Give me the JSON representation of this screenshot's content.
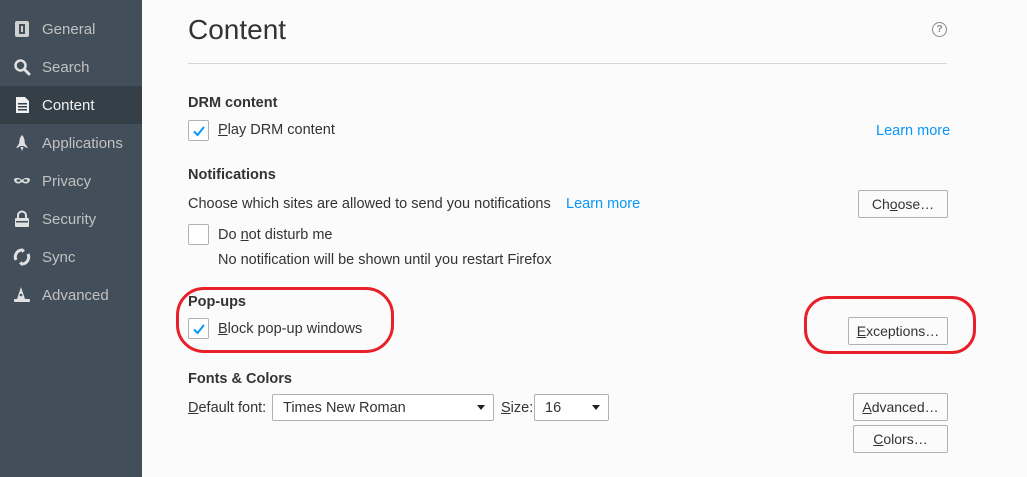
{
  "sidebar": {
    "items": [
      {
        "label": "General",
        "icon": "general-icon",
        "selected": false
      },
      {
        "label": "Search",
        "icon": "search-icon",
        "selected": false
      },
      {
        "label": "Content",
        "icon": "content-icon",
        "selected": true
      },
      {
        "label": "Applications",
        "icon": "rocket-icon",
        "selected": false
      },
      {
        "label": "Privacy",
        "icon": "mask-icon",
        "selected": false
      },
      {
        "label": "Security",
        "icon": "lock-icon",
        "selected": false
      },
      {
        "label": "Sync",
        "icon": "sync-icon",
        "selected": false
      },
      {
        "label": "Advanced",
        "icon": "wizard-hat-icon",
        "selected": false
      }
    ]
  },
  "main": {
    "title": "Content",
    "help_icon": "?",
    "drm": {
      "heading": "DRM content",
      "checkbox_label_key": "P",
      "checkbox_label_rest": "lay DRM content",
      "checked": true,
      "learn_more": "Learn more"
    },
    "notifications": {
      "heading": "Notifications",
      "description": "Choose which sites are allowed to send you notifications",
      "learn_more": "Learn more",
      "choose_button_pre": "Ch",
      "choose_button_key": "o",
      "choose_button_post": "ose…",
      "dnd_label_pre": "Do ",
      "dnd_label_key": "n",
      "dnd_label_post": "ot disturb me",
      "dnd_checked": false,
      "dnd_note": "No notification will be shown until you restart Firefox"
    },
    "popups": {
      "heading": "Pop-ups",
      "checkbox_label_key": "B",
      "checkbox_label_rest": "lock pop-up windows",
      "checked": true,
      "exceptions_button_key": "E",
      "exceptions_button_rest": "xceptions…"
    },
    "fonts": {
      "heading": "Fonts & Colors",
      "default_font_label_key": "D",
      "default_font_label_rest": "efault font:",
      "default_font_value": "Times New Roman",
      "size_label_key": "S",
      "size_label_rest": "ize:",
      "size_value": "16",
      "advanced_button_key": "A",
      "advanced_button_rest": "dvanced…",
      "colors_button_key": "C",
      "colors_button_rest": "olors…"
    }
  },
  "colors": {
    "sidebar_bg": "#424f5a",
    "sidebar_selected": "#343f48",
    "link": "#0996f8",
    "checkmark": "#0996f8",
    "annotation": "#e8202a"
  }
}
